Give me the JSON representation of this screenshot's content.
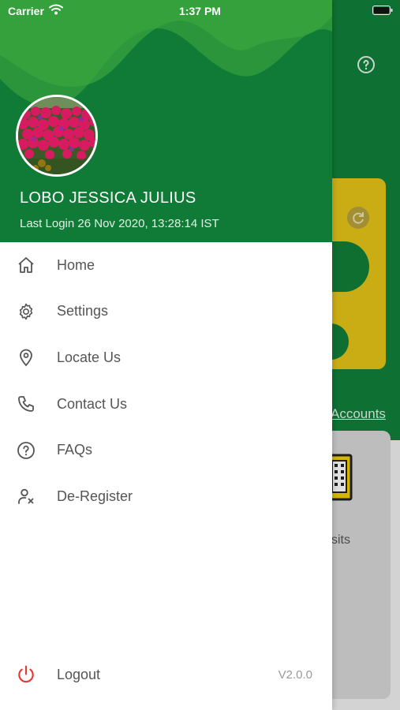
{
  "status_bar": {
    "carrier": "Carrier",
    "time": "1:37 PM"
  },
  "background": {
    "accounts_link": "Accounts",
    "deposits_label": "sits"
  },
  "drawer": {
    "user_name": "LOBO JESSICA JULIUS",
    "last_login": "Last Login 26 Nov 2020, 13:28:14 IST",
    "menu": [
      {
        "label": "Home",
        "icon": "home-icon"
      },
      {
        "label": "Settings",
        "icon": "gear-icon"
      },
      {
        "label": "Locate Us",
        "icon": "location-pin-icon"
      },
      {
        "label": "Contact Us",
        "icon": "phone-icon"
      },
      {
        "label": "FAQs",
        "icon": "question-circle-icon"
      },
      {
        "label": "De-Register",
        "icon": "user-remove-icon"
      }
    ],
    "logout": {
      "label": "Logout",
      "icon": "power-icon",
      "version": "V2.0.0"
    }
  },
  "colors": {
    "primary_green": "#107b36",
    "accent_yellow": "#e6c419",
    "logout_red": "#e53935",
    "menu_text": "#555555"
  }
}
